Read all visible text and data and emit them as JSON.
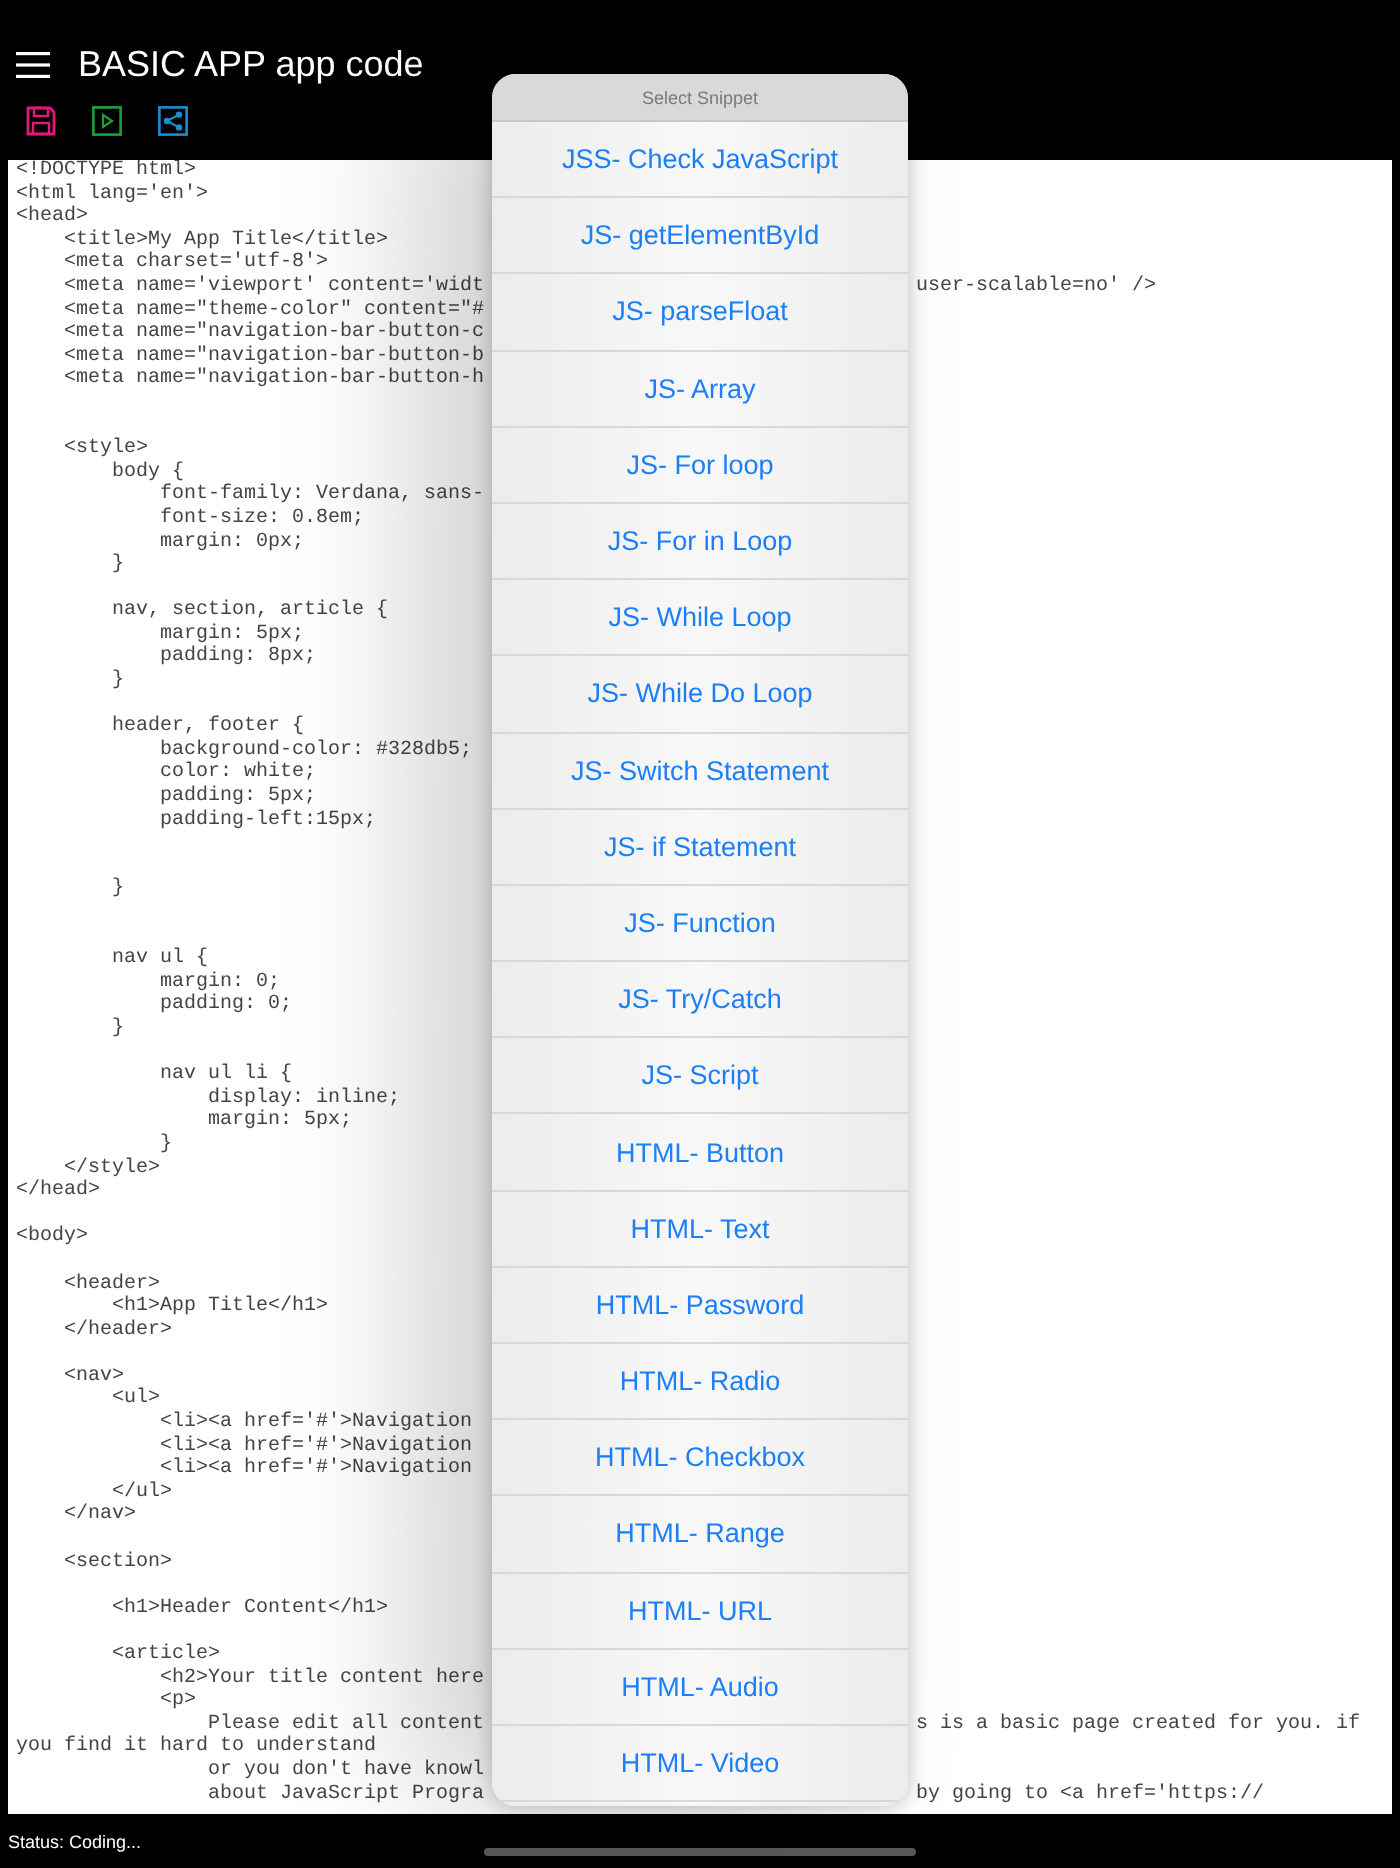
{
  "app_bar": {
    "title": "BASIC APP app code"
  },
  "editor": {
    "lines": [
      {
        "kind": "code",
        "text": "<!DOCTYPE html>"
      },
      {
        "kind": "code",
        "text": "<html lang='en'>"
      },
      {
        "kind": "code",
        "text": "<head>"
      },
      {
        "kind": "code",
        "text": "    <title>My App Title</title>"
      },
      {
        "kind": "code",
        "text": "    <meta charset='utf-8'>"
      },
      {
        "kind": "code",
        "text": "    <meta name='viewport' content='widt",
        "right": "user-scalable=no' />"
      },
      {
        "kind": "code",
        "text": "    <meta name=\"theme-color\" content=\"#"
      },
      {
        "kind": "code",
        "text": "    <meta name=\"navigation-bar-button-c"
      },
      {
        "kind": "code",
        "text": "    <meta name=\"navigation-bar-button-b"
      },
      {
        "kind": "code",
        "text": "    <meta name=\"navigation-bar-button-h"
      },
      {
        "kind": "blank"
      },
      {
        "kind": "blank"
      },
      {
        "kind": "code",
        "text": "    <style>"
      },
      {
        "kind": "code",
        "text": "        body {"
      },
      {
        "kind": "code",
        "text": "            font-family: Verdana, sans-"
      },
      {
        "kind": "code",
        "text": "            font-size: 0.8em;"
      },
      {
        "kind": "code",
        "text": "            margin: 0px;"
      },
      {
        "kind": "code",
        "text": "        }"
      },
      {
        "kind": "blank"
      },
      {
        "kind": "code",
        "text": "        nav, section, article {"
      },
      {
        "kind": "code",
        "text": "            margin: 5px;"
      },
      {
        "kind": "code",
        "text": "            padding: 8px;"
      },
      {
        "kind": "code",
        "text": "        }"
      },
      {
        "kind": "blank"
      },
      {
        "kind": "code",
        "text": "        header, footer {"
      },
      {
        "kind": "code",
        "text": "            background-color: #328db5;"
      },
      {
        "kind": "code",
        "text": "            color: white;"
      },
      {
        "kind": "code",
        "text": "            padding: 5px;"
      },
      {
        "kind": "code",
        "text": "            padding-left:15px;"
      },
      {
        "kind": "blank"
      },
      {
        "kind": "blank"
      },
      {
        "kind": "code",
        "text": "        }"
      },
      {
        "kind": "blank"
      },
      {
        "kind": "blank"
      },
      {
        "kind": "code",
        "text": "        nav ul {"
      },
      {
        "kind": "code",
        "text": "            margin: 0;"
      },
      {
        "kind": "code",
        "text": "            padding: 0;"
      },
      {
        "kind": "code",
        "text": "        }"
      },
      {
        "kind": "blank"
      },
      {
        "kind": "code",
        "text": "            nav ul li {"
      },
      {
        "kind": "code",
        "text": "                display: inline;"
      },
      {
        "kind": "code",
        "text": "                margin: 5px;"
      },
      {
        "kind": "code",
        "text": "            }"
      },
      {
        "kind": "code",
        "text": "    </style>"
      },
      {
        "kind": "code",
        "text": "</head>"
      },
      {
        "kind": "blank"
      },
      {
        "kind": "code",
        "text": "<body>"
      },
      {
        "kind": "blank"
      },
      {
        "kind": "code",
        "text": "    <header>"
      },
      {
        "kind": "code",
        "text": "        <h1>App Title</h1>"
      },
      {
        "kind": "code",
        "text": "    </header>"
      },
      {
        "kind": "blank"
      },
      {
        "kind": "code",
        "text": "    <nav>"
      },
      {
        "kind": "code",
        "text": "        <ul>"
      },
      {
        "kind": "code",
        "text": "            <li><a href='#'>Navigation"
      },
      {
        "kind": "code",
        "text": "            <li><a href='#'>Navigation"
      },
      {
        "kind": "code",
        "text": "            <li><a href='#'>Navigation"
      },
      {
        "kind": "code",
        "text": "        </ul>"
      },
      {
        "kind": "code",
        "text": "    </nav>"
      },
      {
        "kind": "blank"
      },
      {
        "kind": "code",
        "text": "    <section>"
      },
      {
        "kind": "blank"
      },
      {
        "kind": "code",
        "text": "        <h1>Header Content</h1>"
      },
      {
        "kind": "blank"
      },
      {
        "kind": "code",
        "text": "        <article>"
      },
      {
        "kind": "code",
        "text": "            <h2>Your title content here"
      },
      {
        "kind": "code",
        "text": "            <p>"
      },
      {
        "kind": "code",
        "text": "                Please edit all content",
        "right": "s is a basic page created for you. if"
      },
      {
        "kind": "code",
        "text": "you find it hard to understand"
      },
      {
        "kind": "code",
        "text": "                or you don't have knowl"
      },
      {
        "kind": "code",
        "text": "                about JavaScript Progra",
        "right": "by going to <a href='https://"
      }
    ]
  },
  "snippet_picker": {
    "title": "Select Snippet",
    "items": [
      "JSS- Check JavaScript",
      "JS- getElementById",
      "JS- parseFloat",
      "JS- Array",
      "JS- For loop",
      "JS- For in Loop",
      "JS- While Loop",
      "JS- While Do Loop",
      "JS- Switch Statement",
      "JS- if Statement",
      "JS- Function",
      "JS- Try/Catch",
      "JS- Script",
      "HTML- Button",
      "HTML- Text",
      "HTML- Password",
      "HTML- Radio",
      "HTML- Checkbox",
      "HTML- Range",
      "HTML- URL",
      "HTML- Audio",
      "HTML- Video"
    ]
  },
  "status_bar": {
    "text": "Status: Coding..."
  }
}
